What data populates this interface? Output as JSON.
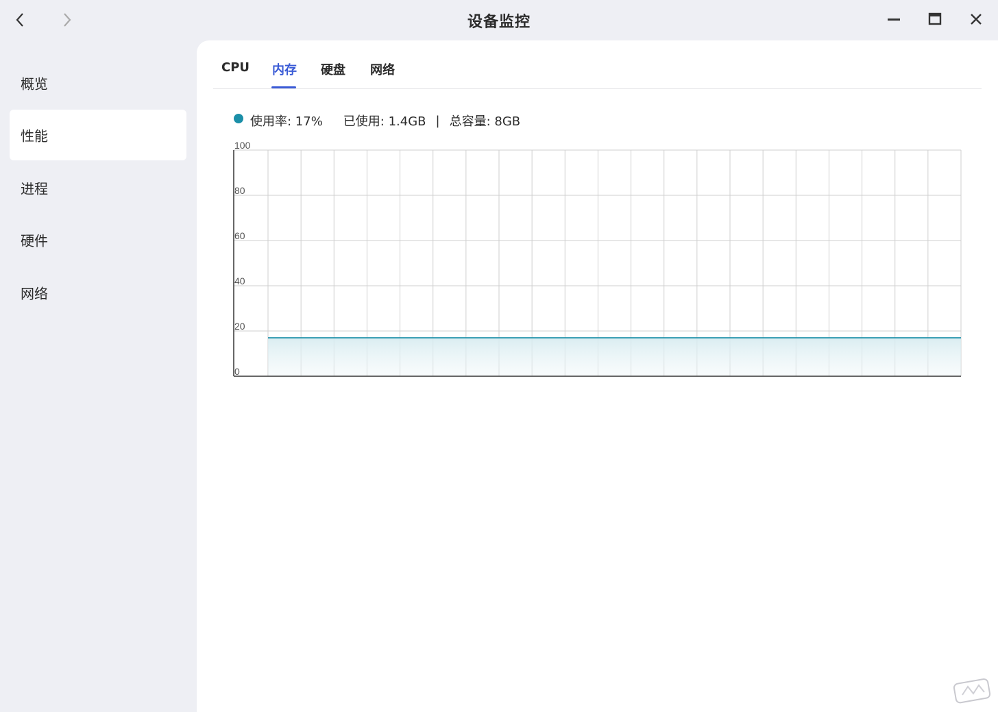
{
  "window": {
    "title": "设备监控",
    "controls": {
      "minimize": "minimize",
      "maximize": "maximize",
      "close": "close"
    }
  },
  "sidebar": {
    "items": [
      {
        "label": "概览",
        "active": false
      },
      {
        "label": "性能",
        "active": true
      },
      {
        "label": "进程",
        "active": false
      },
      {
        "label": "硬件",
        "active": false
      },
      {
        "label": "网络",
        "active": false
      }
    ]
  },
  "tabs": [
    {
      "label": "CPU",
      "active": false
    },
    {
      "label": "内存",
      "active": true
    },
    {
      "label": "硬盘",
      "active": false
    },
    {
      "label": "网络",
      "active": false
    }
  ],
  "legend": {
    "usage": "使用率: 17%",
    "used": "已使用: 1.4GB",
    "separator": "|",
    "total": "总容量: 8GB",
    "color": "#1b8fa8"
  },
  "colors": {
    "accent": "#3a5bd6",
    "series": "#1b8fa8",
    "background": "#eeeff4",
    "panel": "#ffffff"
  },
  "chart_data": {
    "type": "area",
    "yticks": [
      "100",
      "80",
      "60",
      "40",
      "20",
      "0"
    ],
    "ylim": [
      0,
      100
    ],
    "x_count": 21,
    "series": [
      {
        "values": [
          17,
          17,
          17,
          17,
          17,
          17,
          17,
          17,
          17,
          17,
          17,
          17,
          17,
          17,
          17,
          17,
          17,
          17,
          17,
          17,
          17,
          17
        ]
      }
    ],
    "grid": true
  }
}
